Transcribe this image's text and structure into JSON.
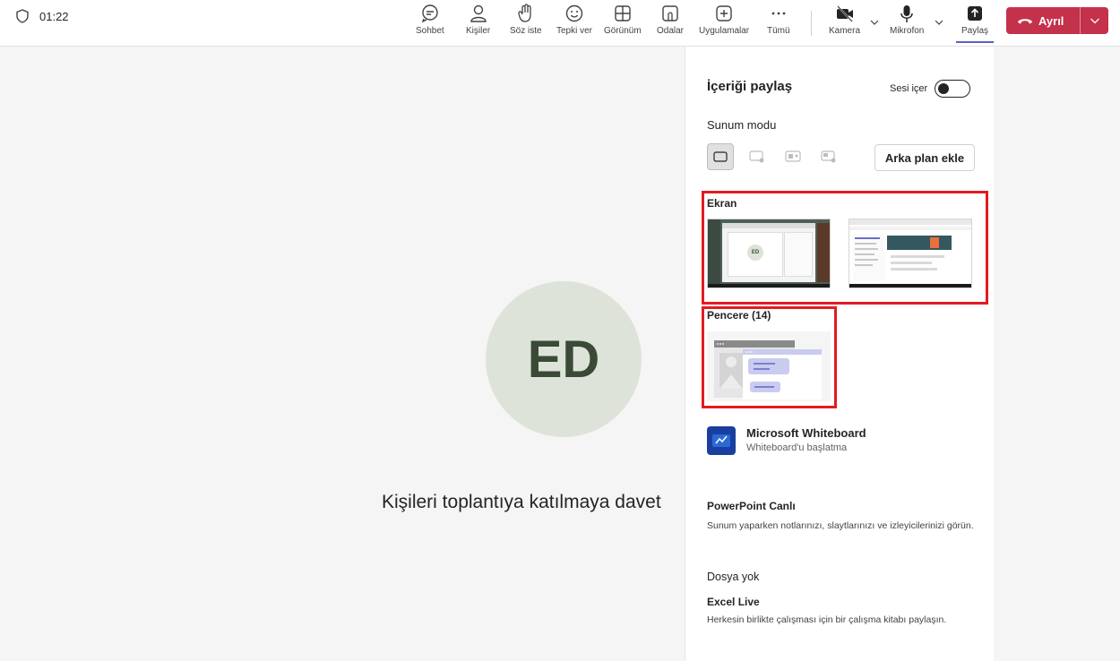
{
  "meeting": {
    "timer": "01:22"
  },
  "toolbar": {
    "chat": "Sohbet",
    "people": "Kişiler",
    "raise_hand": "Söz iste",
    "react": "Tepki ver",
    "view": "Görünüm",
    "rooms": "Odalar",
    "apps": "Uygulamalar",
    "more": "Tümü",
    "camera": "Kamera",
    "mic": "Mikrofon",
    "share": "Paylaş",
    "leave": "Ayrıl"
  },
  "stage": {
    "avatar_initials": "ED",
    "invite_text": "Kişileri toplantıya katılmaya davet"
  },
  "share_panel": {
    "title": "İçeriği paylaş",
    "include_sound": "Sesi içer",
    "presenter_mode_label": "Sunum modu",
    "add_background": "Arka plan ekle",
    "screen_label": "Ekran",
    "window_label": "Pencere (14)",
    "thumb_avatar": "ED",
    "whiteboard": {
      "title": "Microsoft Whiteboard",
      "subtitle": "Whiteboard'u başlatma"
    },
    "powerpoint": {
      "title": "PowerPoint Canlı",
      "desc": "Sunum yaparken notlarınızı, slaytlarınızı ve izleyicilerinizi görün."
    },
    "no_files": "Dosya yok",
    "excel": {
      "title": "Excel Live",
      "desc": "Herkesin birlikte çalışması için bir çalışma kitabı paylaşın."
    }
  },
  "colors": {
    "leave_red": "#c4314b",
    "accent": "#5b5fc7",
    "highlight_red": "#e21b23"
  }
}
